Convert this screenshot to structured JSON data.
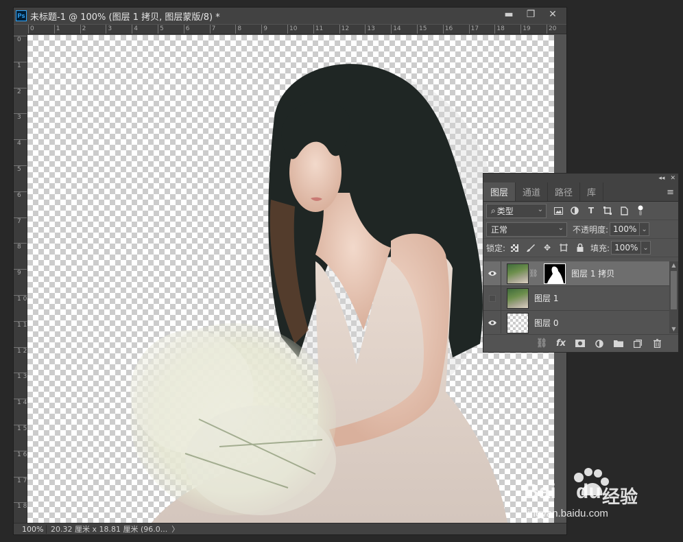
{
  "document": {
    "title": "未标题-1 @ 100% (图层 1 拷贝, 图层蒙版/8) *",
    "app_icon": "Ps",
    "window_buttons": [
      "▬",
      "❐",
      "✕"
    ],
    "ruler_h": [
      "0",
      "1",
      "2",
      "3",
      "4",
      "5",
      "6",
      "7",
      "8",
      "9",
      "10",
      "11",
      "12",
      "13",
      "14",
      "15",
      "16",
      "17",
      "18",
      "19",
      "20"
    ],
    "ruler_v": [
      "0",
      "1",
      "2",
      "3",
      "4",
      "5",
      "6",
      "7",
      "8",
      "9",
      "1 0",
      "1 1",
      "1 2",
      "1 3",
      "1 4",
      "1 5",
      "1 6",
      "1 7",
      "1 8"
    ],
    "status": {
      "zoom": "100%",
      "info": "20.32 厘米 x 18.81 厘米 (96.0...",
      "arrow": "〉"
    }
  },
  "layers_panel": {
    "collapse": "◂◂",
    "close": "✕",
    "tabs": [
      "图层",
      "通道",
      "路径",
      "库"
    ],
    "menu_icon": "≡",
    "filter": {
      "value": "类型",
      "prefix": "⌕"
    },
    "blend_mode": "正常",
    "opacity_label": "不透明度:",
    "opacity_value": "100%",
    "lock_label": "锁定:",
    "fill_label": "填充:",
    "fill_value": "100%",
    "layers": [
      {
        "name": "图层 1 拷贝",
        "visible": true,
        "selected": true,
        "has_mask": true
      },
      {
        "name": "图层 1",
        "visible": false,
        "selected": false,
        "has_mask": false
      },
      {
        "name": "图层 0",
        "visible": true,
        "selected": false,
        "has_mask": false
      }
    ]
  },
  "watermark": {
    "brand": "Bai",
    "brand2": "du",
    "cn": "经验",
    "url": "jingyan.baidu.com"
  }
}
